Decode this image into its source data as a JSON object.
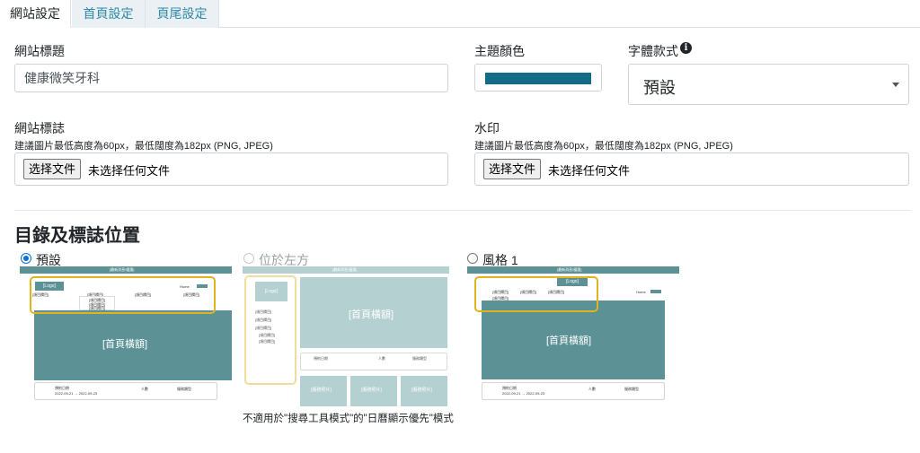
{
  "tabs": [
    {
      "label": "網站設定",
      "active": true
    },
    {
      "label": "首頁設定",
      "active": false
    },
    {
      "label": "頁尾設定",
      "active": false
    }
  ],
  "site_title": {
    "label": "網站標題",
    "value": "健康微笑牙科"
  },
  "theme_color": {
    "label": "主題顏色",
    "value": "#136c85"
  },
  "font_style": {
    "label": "字體款式",
    "value": "預設",
    "icon": "info-icon"
  },
  "site_logo": {
    "label": "網站標誌",
    "hint": "建議圖片最低高度為60px，最低闊度為182px (PNG, JPEG)",
    "button": "选择文件",
    "status": "未选择任何文件"
  },
  "watermark": {
    "label": "水印",
    "hint": "建議圖片最低高度為60px，最低闊度為182px (PNG, JPEG)",
    "button": "选择文件",
    "status": "未选择任何文件"
  },
  "layout_section": {
    "title": "目錄及標誌位置",
    "options": [
      {
        "label": "預設",
        "checked": true,
        "disabled": false
      },
      {
        "label": "位於左方",
        "checked": false,
        "disabled": true
      },
      {
        "label": "風格 1",
        "checked": false,
        "disabled": false
      }
    ],
    "note": "不適用於\"搜尋工具模式\"的\"日曆顯示優先\"模式"
  },
  "previews": {
    "logo": "[Logo]",
    "banner": "[首頁橫額]",
    "service_photo": "[服務照片]",
    "top_bar": "[最新消息/優惠]",
    "menu_item": "[項目欄目]",
    "sub_item": "[項目欄目]",
    "home_link": "Home",
    "booking_label": "預約日期",
    "booking_date": "2022-09-21 → 2022-09-23",
    "people_label": "人數",
    "filter_label": "服務類型"
  },
  "colors": {
    "accent": "#e0b421",
    "teal": "#5c9296",
    "teal_light": "#a8c8ca",
    "link": "#2f8aa8",
    "radio": "#0b6fd8"
  }
}
